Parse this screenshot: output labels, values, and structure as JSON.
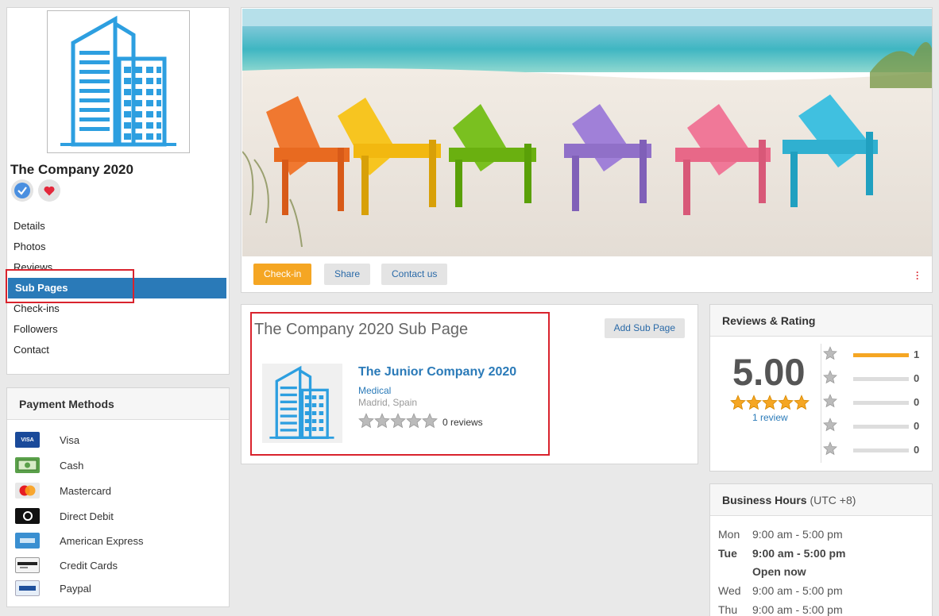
{
  "profile": {
    "name": "The Company 2020",
    "nav": [
      "Details",
      "Photos",
      "Reviews",
      "Sub Pages",
      "Check-ins",
      "Followers",
      "Contact"
    ],
    "active_nav": "Sub Pages"
  },
  "payment": {
    "title": "Payment Methods",
    "items": [
      {
        "label": "Visa",
        "icon": "visa-icon",
        "badge": "VISA"
      },
      {
        "label": "Cash",
        "icon": "cash-icon",
        "badge": ""
      },
      {
        "label": "Mastercard",
        "icon": "mastercard-icon",
        "badge": ""
      },
      {
        "label": "Direct Debit",
        "icon": "direct-debit-icon",
        "badge": ""
      },
      {
        "label": "American Express",
        "icon": "amex-icon",
        "badge": ""
      },
      {
        "label": "Credit Cards",
        "icon": "credit-card-icon",
        "badge": ""
      },
      {
        "label": "Paypal",
        "icon": "paypal-icon",
        "badge": ""
      }
    ]
  },
  "cover": {
    "checkin_label": "Check-in",
    "share_label": "Share",
    "contact_label": "Contact us"
  },
  "subpage": {
    "title": "The Company 2020 Sub Page",
    "add_label": "Add Sub Page",
    "item": {
      "name": "The Junior Company 2020",
      "category": "Medical",
      "location": "Madrid, Spain",
      "reviews": "0 reviews",
      "rating": 0
    }
  },
  "reviews": {
    "title": "Reviews & Rating",
    "average": "5.00",
    "review_link": "1 review",
    "distribution": [
      {
        "stars": 5,
        "count": "1",
        "fraction": 1
      },
      {
        "stars": 4,
        "count": "0",
        "fraction": 0
      },
      {
        "stars": 3,
        "count": "0",
        "fraction": 0
      },
      {
        "stars": 2,
        "count": "0",
        "fraction": 0
      },
      {
        "stars": 1,
        "count": "0",
        "fraction": 0
      }
    ]
  },
  "hours": {
    "title": "Business Hours",
    "timezone": "(UTC +8)",
    "rows": [
      {
        "day": "Mon",
        "time": "9:00 am - 5:00 pm",
        "today": false
      },
      {
        "day": "Tue",
        "time": "9:00 am - 5:00 pm",
        "today": true
      },
      {
        "day": "",
        "time": "Open now",
        "today": true
      },
      {
        "day": "Wed",
        "time": "9:00 am - 5:00 pm",
        "today": false
      },
      {
        "day": "Thu",
        "time": "9:00 am - 5:00 pm",
        "today": false
      }
    ]
  },
  "colors": {
    "brand_blue": "#2a7ab8",
    "accent_orange": "#f5a623",
    "highlight_red": "#d9232d",
    "logo_blue": "#2d9fe0"
  }
}
